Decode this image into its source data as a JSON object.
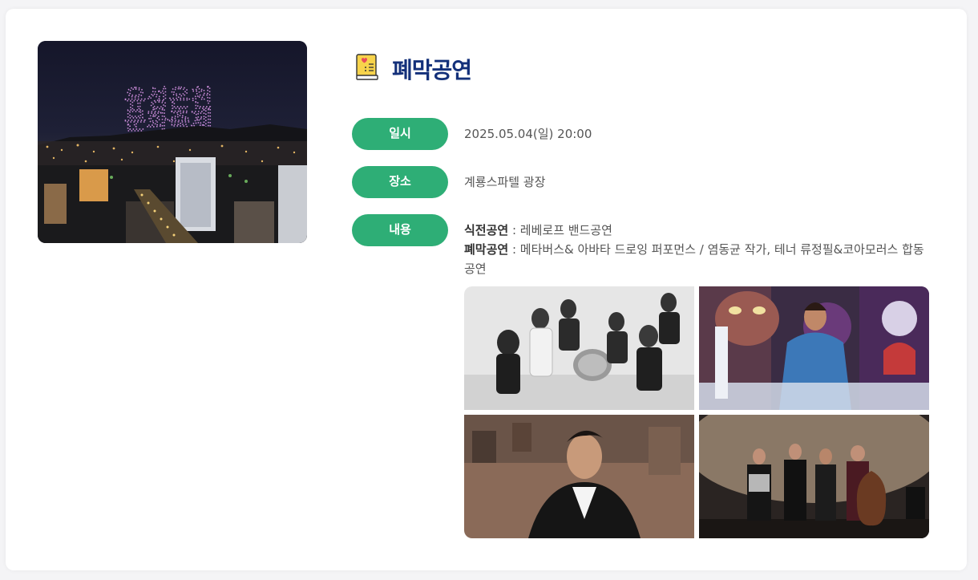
{
  "hero": {
    "sky_text_line1": "유성온천",
    "sky_text_line2": "문화축제"
  },
  "section": {
    "title": "폐막공연",
    "icon": "book-heart-icon"
  },
  "rows": [
    {
      "label": "일시",
      "value": "2025.05.04(일) 20:00"
    },
    {
      "label": "장소",
      "value": "계룡스파텔 광장"
    },
    {
      "label": "내용"
    }
  ],
  "content": {
    "line1_bold": "식전공연",
    "line1_rest": " : 레베로프 밴드공연",
    "line2_bold": "폐막공연",
    "line2_rest": " : 메타버스& 아바타 드로잉 퍼포먼스 / 염동균 작가, 테너 류정필&코아모러스 합동공연"
  },
  "colors": {
    "accent_green": "#2eae76",
    "title_navy": "#13307a"
  }
}
